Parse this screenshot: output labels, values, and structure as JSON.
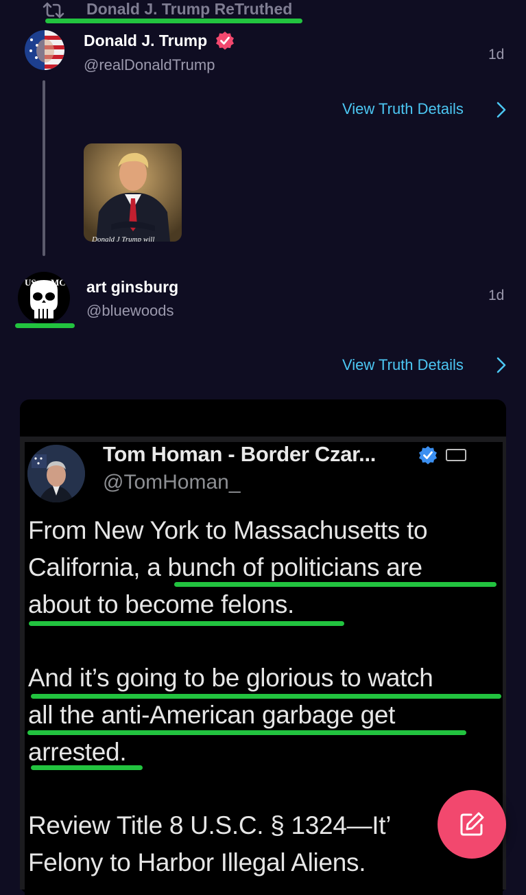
{
  "retruth": {
    "label": "Donald J. Trump ReTruthed"
  },
  "post1": {
    "name": "Donald J. Trump",
    "handle": "@realDonaldTrump",
    "time": "1d",
    "view_details": "View Truth Details",
    "thumb_caption": "Donald J Trump will"
  },
  "post2": {
    "name": "art ginsburg",
    "handle": "@bluewoods",
    "time": "1d",
    "view_details": "View Truth Details",
    "avatar_text_left": "US",
    "avatar_text_right": "MC"
  },
  "embedded_tweet": {
    "name": "Tom Homan - Border Czar...",
    "handle": "@TomHoman_",
    "lines": [
      "From New York to Massachusetts to",
      "California, a bunch of politicians are",
      "about to become felons.",
      "And it’s going to be glorious to watch",
      "all the anti-American garbage get",
      "arrested.",
      "Review Title 8 U.S.C. § 1324—It’",
      "Felony to Harbor Illegal Aliens."
    ]
  },
  "icons": {
    "retruth": "retruth-icon",
    "verified": "verified-badge-icon",
    "chevron": "chevron-right-icon",
    "compose": "compose-icon"
  },
  "colors": {
    "background": "#0f0d22",
    "link": "#4cc7f3",
    "verified_badge": "#f2486e",
    "highlight": "#22c33f",
    "fab": "#f2486e"
  }
}
